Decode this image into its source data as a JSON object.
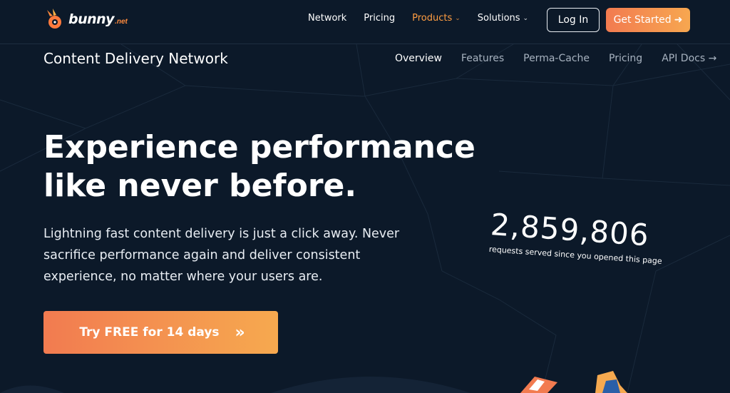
{
  "brand": {
    "name": "bunny",
    "tld": ".net"
  },
  "topnav": {
    "items": [
      {
        "label": "Network",
        "active": false,
        "dropdown": false
      },
      {
        "label": "Pricing",
        "active": false,
        "dropdown": false
      },
      {
        "label": "Products",
        "active": true,
        "dropdown": true
      },
      {
        "label": "Solutions",
        "active": false,
        "dropdown": true
      }
    ],
    "login_label": "Log In",
    "start_label": "Get Started"
  },
  "subnav": {
    "title": "Content Delivery Network",
    "items": [
      {
        "label": "Overview",
        "current": true
      },
      {
        "label": "Features",
        "current": false
      },
      {
        "label": "Perma-Cache",
        "current": false
      },
      {
        "label": "Pricing",
        "current": false
      },
      {
        "label": "API Docs",
        "current": false
      }
    ]
  },
  "hero": {
    "title_line1": "Experience performance",
    "title_line2": "like never before.",
    "description": "Lightning fast content delivery is just a click away. Never sacrifice performance again and deliver consistent experience, no matter where your users are.",
    "cta_label": "Try FREE for 14 days"
  },
  "counter": {
    "value": "2,859,806",
    "caption": "requests served since you opened this page"
  },
  "colors": {
    "background": "#0c1929",
    "accent": "#ff9d42",
    "cta_start": "#f27b50",
    "cta_end": "#f6a94f"
  }
}
